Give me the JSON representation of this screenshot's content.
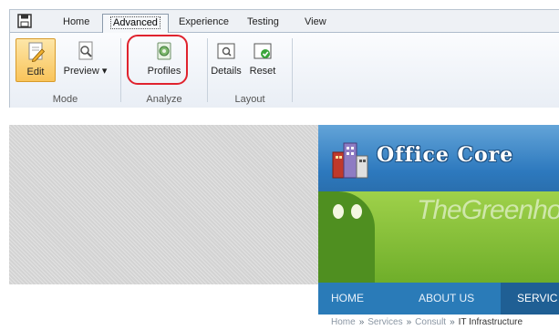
{
  "ribbon": {
    "tabs": [
      {
        "label": "Home"
      },
      {
        "label": "Advanced"
      },
      {
        "label": "Experience"
      },
      {
        "label": "Testing"
      },
      {
        "label": "View"
      }
    ],
    "groups": {
      "mode": {
        "label": "Mode",
        "edit": "Edit",
        "preview": "Preview ▾"
      },
      "analyze": {
        "label": "Analyze",
        "profiles": "Profiles"
      },
      "layout": {
        "label": "Layout",
        "details": "Details",
        "reset": "Reset"
      }
    }
  },
  "site": {
    "logo_text": "Office Core",
    "banner_text": "TheGreenhouse",
    "nav": [
      {
        "label": "HOME"
      },
      {
        "label": "ABOUT US"
      },
      {
        "label": "SERVIC"
      }
    ],
    "breadcrumb": {
      "items": [
        "Home",
        "Services",
        "Consult"
      ],
      "separator": "»",
      "current": "IT Infrastructure"
    }
  },
  "colors": {
    "highlight": "#e0232e",
    "site_nav": "#2a7bb8",
    "site_header": "#2d79be"
  }
}
